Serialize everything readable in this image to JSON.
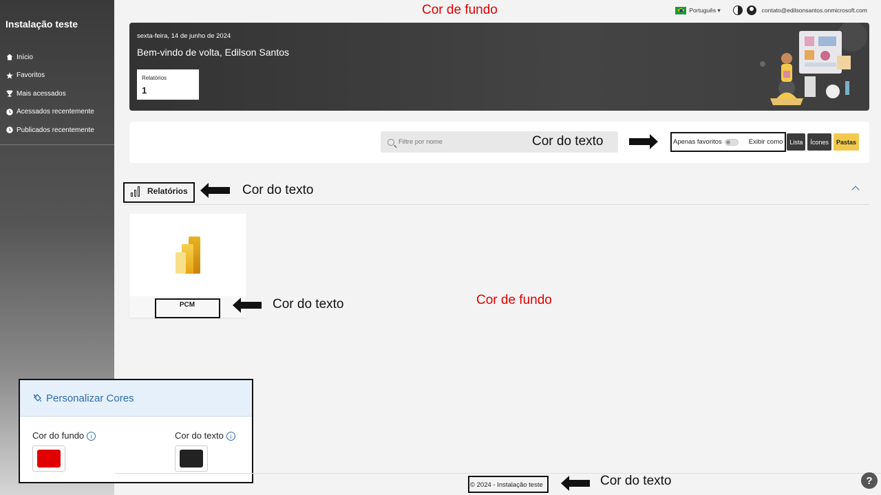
{
  "app": {
    "title": "Instalação teste"
  },
  "sidebar": {
    "items": [
      {
        "label": "Início",
        "icon": "home-icon"
      },
      {
        "label": "Favoritos",
        "icon": "star-icon"
      },
      {
        "label": "Mais acessados",
        "icon": "trophy-icon"
      },
      {
        "label": "Acessados recentemente",
        "icon": "clock-icon"
      },
      {
        "label": "Publicados recentemente",
        "icon": "clock-icon"
      }
    ]
  },
  "topbar": {
    "language": "Português",
    "user_email": "contato@edilsonsantos.onmicrosoft.com"
  },
  "banner": {
    "date": "sexta-feira, 14 de junho de 2024",
    "welcome": "Bem-vindo de volta, Edilson Santos",
    "stat_label": "Relatórios",
    "stat_value": "1"
  },
  "filter": {
    "search_placeholder": "Filtre por nome",
    "favorites_label": "Apenas favoritos",
    "display_label": "Exibir como",
    "views": [
      "Lista",
      "Ícones",
      "Pastas"
    ],
    "active_view": "Pastas"
  },
  "section": {
    "title": "Relatórios"
  },
  "reports": [
    {
      "name": "PCM"
    }
  ],
  "panel": {
    "title": "Personalizar Cores",
    "bg_label": "Cor do fundo",
    "text_label": "Cor do texto",
    "bg_color": "#e00000",
    "text_color": "#222222"
  },
  "footer": {
    "text": "© 2024 - Instalação teste"
  },
  "annotations": {
    "bg_top": "Cor de fundo",
    "text_search": "Cor do texto",
    "text_section": "Cor do texto",
    "text_card": "Cor do texto",
    "bg_main": "Cor de fundo",
    "text_footer": "Cor do texto"
  },
  "colors": {
    "accent": "#f2c94c",
    "link": "#2b6cb0",
    "annotation_red": "#e00000"
  }
}
